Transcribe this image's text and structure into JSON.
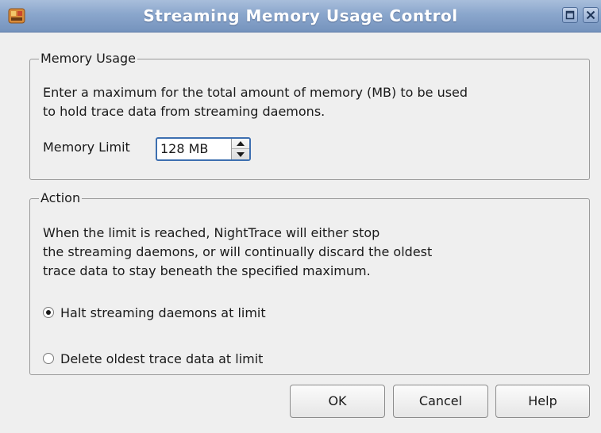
{
  "window": {
    "title": "Streaming Memory Usage Control",
    "app_icon": "nighttrace-app-icon",
    "titlebar_buttons": [
      "maximize-icon",
      "close-icon"
    ]
  },
  "memory_usage": {
    "group_title": "Memory Usage",
    "description_lines": [
      "Enter a maximum for the total amount of memory (MB) to be used",
      "to hold trace data from streaming daemons."
    ],
    "limit_label": "Memory Limit",
    "limit_value": "128 MB"
  },
  "action": {
    "group_title": "Action",
    "description_lines": [
      "When the limit is reached, NightTrace will either stop",
      "the streaming daemons, or will continually discard the oldest",
      "trace data to stay beneath the specified maximum."
    ],
    "options": [
      {
        "label": "Halt streaming daemons at limit",
        "checked": true
      },
      {
        "label": "Delete oldest trace data at limit",
        "checked": false
      }
    ]
  },
  "buttons": {
    "ok": "OK",
    "cancel": "Cancel",
    "help": "Help"
  },
  "colors": {
    "titlebar": "#8aa6cc",
    "background": "#efefef",
    "focus_border": "#3d6fb0"
  }
}
